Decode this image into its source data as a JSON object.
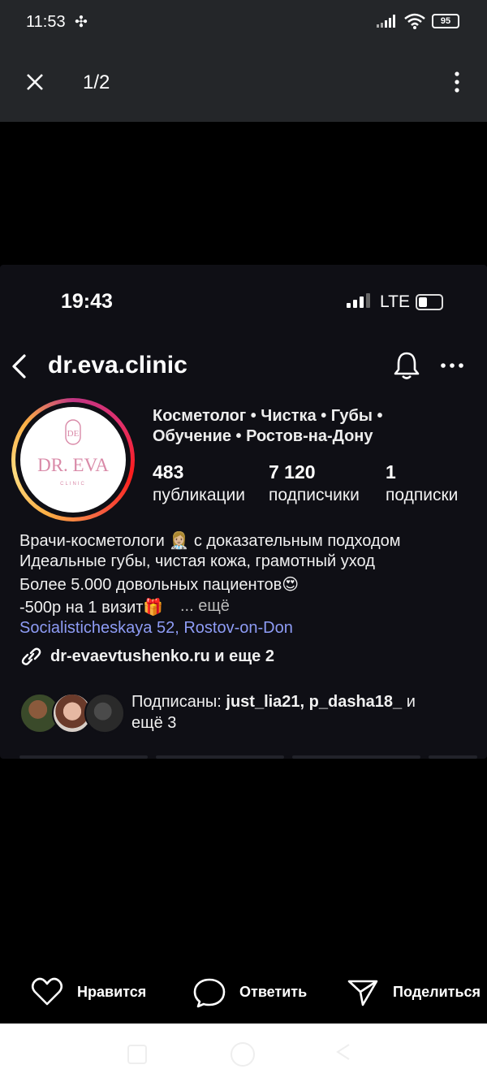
{
  "device_status": {
    "time": "11:53",
    "battery": "95"
  },
  "viewer": {
    "counter": "1/2"
  },
  "inner_status": {
    "time": "19:43",
    "network": "LTE"
  },
  "profile": {
    "username": "dr.eva.clinic",
    "logo_text": "DR. EVA",
    "logo_sub": "CLINIC",
    "logo_monogram": "DE",
    "category_line1": "Косметолог • Чистка • Губы •",
    "category_line2": "Обучение • Ростов-на-Дону",
    "stats": [
      {
        "value": "483",
        "label": "публикации"
      },
      {
        "value": "7 120",
        "label": "подписчики"
      },
      {
        "value": "1",
        "label": "подписки"
      }
    ],
    "bio": [
      "Врачи-косметологи 👩🏼‍⚕️ с доказательным подходом",
      "Идеальные губы, чистая кожа, грамотный уход",
      "Более 5.000 довольных пациентов😍",
      "-500р на 1 визит🎁"
    ],
    "bio_more": "... ещё",
    "address": "Socialisticheskaya 52, Rostov-on-Don",
    "link": "dr-evaevtushenko.ru и еще 2",
    "followed_by": {
      "prefix": "Подписаны: ",
      "names": "just_lia21, p_dasha18_",
      "suffix_line1": " и",
      "line2": "ещё 3"
    }
  },
  "actions": {
    "like": "Нравится",
    "reply": "Ответить",
    "share": "Поделиться"
  },
  "colors": {
    "toolbar_bg": "#242629",
    "panel_bg": "#0f0f15",
    "address": "#8e9cf5"
  }
}
